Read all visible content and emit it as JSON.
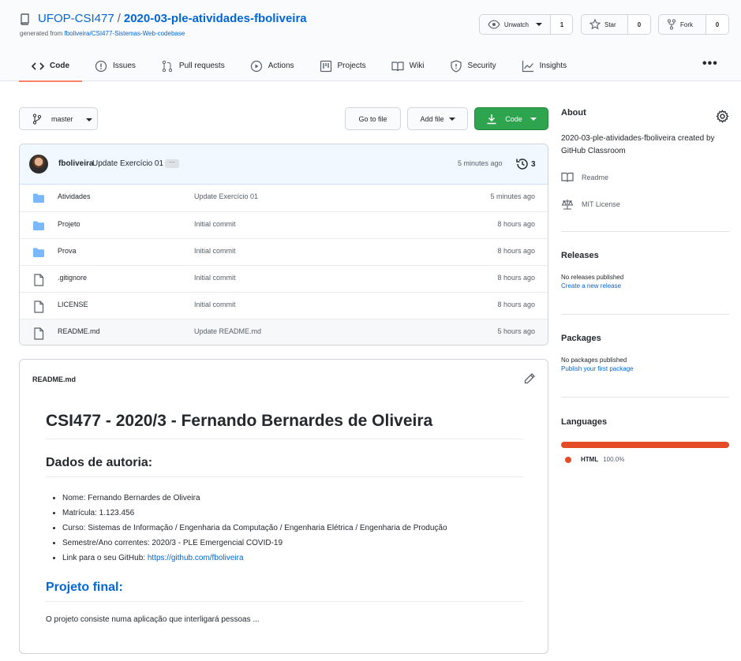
{
  "repo": {
    "owner": "UFOP-CSI477",
    "separator": "/",
    "name": "2020-03-ple-atividades-fboliveira",
    "generated_prefix": "generated from ",
    "generated_link": "fboliveira/CSI477-Sistemas-Web-codebase"
  },
  "actions": {
    "watch_label": "Unwatch",
    "watch_count": "1",
    "star_label": "Star",
    "star_count": "0",
    "fork_label": "Fork",
    "fork_count": "0"
  },
  "tabs": [
    {
      "label": "Code",
      "icon": "code-icon"
    },
    {
      "label": "Issues",
      "icon": "issue-icon"
    },
    {
      "label": "Pull requests",
      "icon": "pull-request-icon"
    },
    {
      "label": "Actions",
      "icon": "play-icon"
    },
    {
      "label": "Projects",
      "icon": "project-icon"
    },
    {
      "label": "Wiki",
      "icon": "book-icon"
    },
    {
      "label": "Security",
      "icon": "shield-icon"
    },
    {
      "label": "Insights",
      "icon": "graph-icon"
    }
  ],
  "toolbar": {
    "branch": "master",
    "goto_file": "Go to file",
    "add_file": "Add file",
    "code": "Code"
  },
  "commit": {
    "author": "fboliveira",
    "message": "Update Exercício 01",
    "time": "5 minutes ago",
    "history_count": "3"
  },
  "files": [
    {
      "type": "folder",
      "name": "Atividades",
      "message": "Update Exercício 01",
      "age": "5 minutes ago"
    },
    {
      "type": "folder",
      "name": "Projeto",
      "message": "Initial commit",
      "age": "8 hours ago"
    },
    {
      "type": "folder",
      "name": "Prova",
      "message": "Initial commit",
      "age": "8 hours ago"
    },
    {
      "type": "file",
      "name": ".gitignore",
      "message": "Initial commit",
      "age": "8 hours ago"
    },
    {
      "type": "file",
      "name": "LICENSE",
      "message": "Initial commit",
      "age": "8 hours ago"
    },
    {
      "type": "file",
      "name": "README.md",
      "message": "Update README.md",
      "age": "5 hours ago"
    }
  ],
  "readme": {
    "filename": "README.md",
    "h1": "CSI477 - 2020/3 - Fernando Bernardes de Oliveira",
    "h2_author": "Dados de autoria:",
    "items": [
      "Nome: Fernando Bernardes de Oliveira",
      "Matrícula: 1.123.456",
      "Curso: Sistemas de Informação / Engenharia da Computação / Engenharia Elétrica / Engenharia de Produção",
      "Semestre/Ano correntes: 2020/3 - PLE Emergencial COVID-19"
    ],
    "github_prefix": "Link para o seu GitHub: ",
    "github_link": "https://github.com/fboliveira",
    "h2_project": "Projeto final:",
    "paragraph": "O projeto consiste numa aplicação que interligará pessoas ..."
  },
  "sidebar": {
    "about_title": "About",
    "description": "2020-03-ple-atividades-fboliveira created by GitHub Classroom",
    "readme": "Readme",
    "license": "MIT License",
    "releases_title": "Releases",
    "releases_none": "No releases published",
    "releases_link": "Create a new release",
    "packages_title": "Packages",
    "packages_none": "No packages published",
    "packages_link": "Publish your first package",
    "languages_title": "Languages",
    "languages": [
      {
        "name": "HTML",
        "percent": "100.0%",
        "color": "#e34c26"
      }
    ]
  },
  "colors": {
    "accent": "#0366d6",
    "green_button": "#2ea44f",
    "active_tab_underline": "#f9826c",
    "folder": "#79b8ff"
  }
}
